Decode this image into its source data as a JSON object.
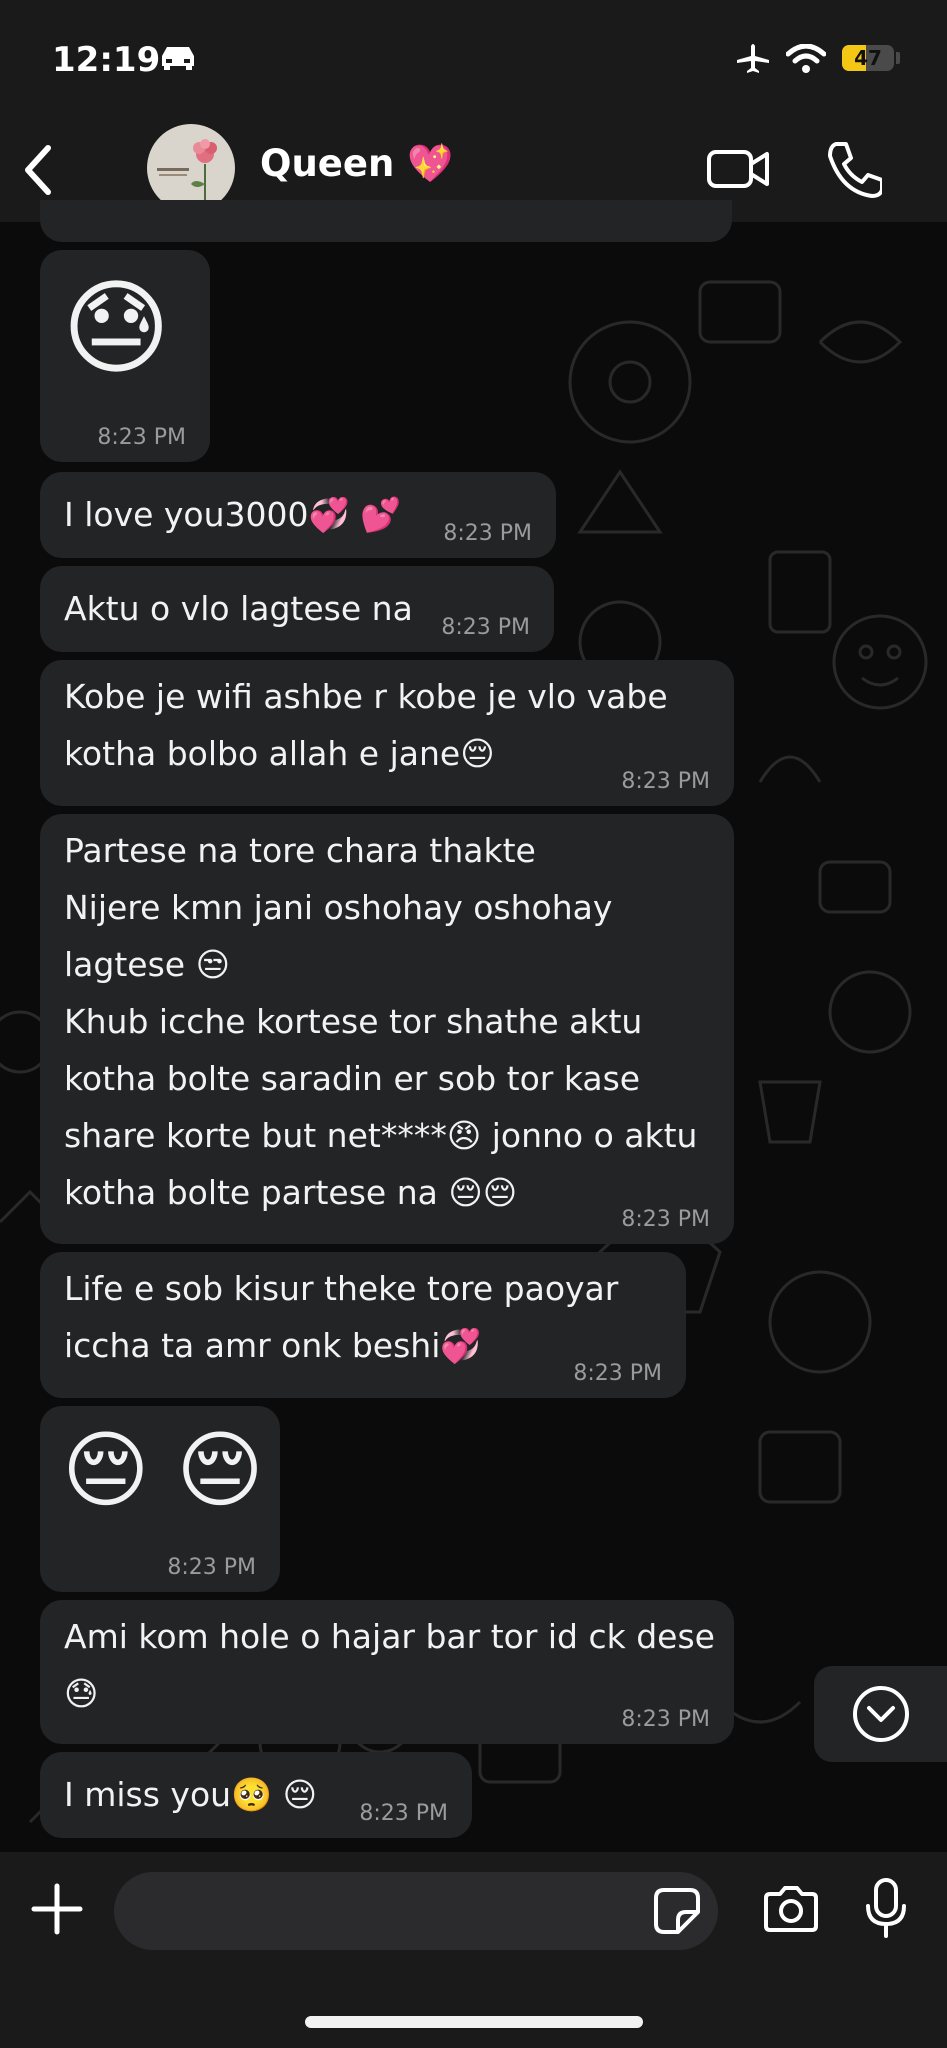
{
  "status_bar": {
    "time": "12:19",
    "battery": "47",
    "battery_level": 0.47
  },
  "header": {
    "contact_name": "Queen 💖"
  },
  "messages": [
    {
      "text": "😓",
      "time": "8:23 PM"
    },
    {
      "text": "I love you3000💞 💕",
      "time": "8:23 PM"
    },
    {
      "text": "Aktu o vlo lagtese na",
      "time": "8:23 PM"
    },
    {
      "text": "Kobe je wifi ashbe r kobe je vlo vabe\nkotha bolbo allah e jane😔",
      "time": "8:23 PM"
    },
    {
      "text": "Partese na tore chara thakte\nNijere kmn jani oshohay oshohay\nlagtese 😒\nKhub icche kortese tor shathe aktu\nkotha bolte saradin er sob tor kase\nshare korte but net****😠 jonno o aktu\nkotha bolte partese na   😔😔",
      "time": "8:23 PM"
    },
    {
      "text": "Life e sob kisur theke tore paoyar\niccha ta amr onk beshi💞",
      "time": "8:23 PM"
    },
    {
      "text": "😔 😔",
      "time": "8:23 PM"
    },
    {
      "text": "Ami kom hole o hajar bar tor id ck dese\n😓",
      "time": "8:23 PM"
    },
    {
      "text": "I miss you🥺 😔",
      "time": "8:23 PM"
    }
  ],
  "colors": {
    "bubble": "#222426",
    "bar": "#1a1a1a",
    "text": "#f2f2f2",
    "timestamp": "#9b9b9b",
    "battery": "#f4c717"
  },
  "icons": [
    "back-chevron-icon",
    "video-camera-icon",
    "phone-icon",
    "plus-icon",
    "sticker-icon",
    "camera-icon",
    "microphone-icon",
    "chevron-down-icon",
    "car-icon",
    "airplane-icon",
    "wifi-icon"
  ]
}
